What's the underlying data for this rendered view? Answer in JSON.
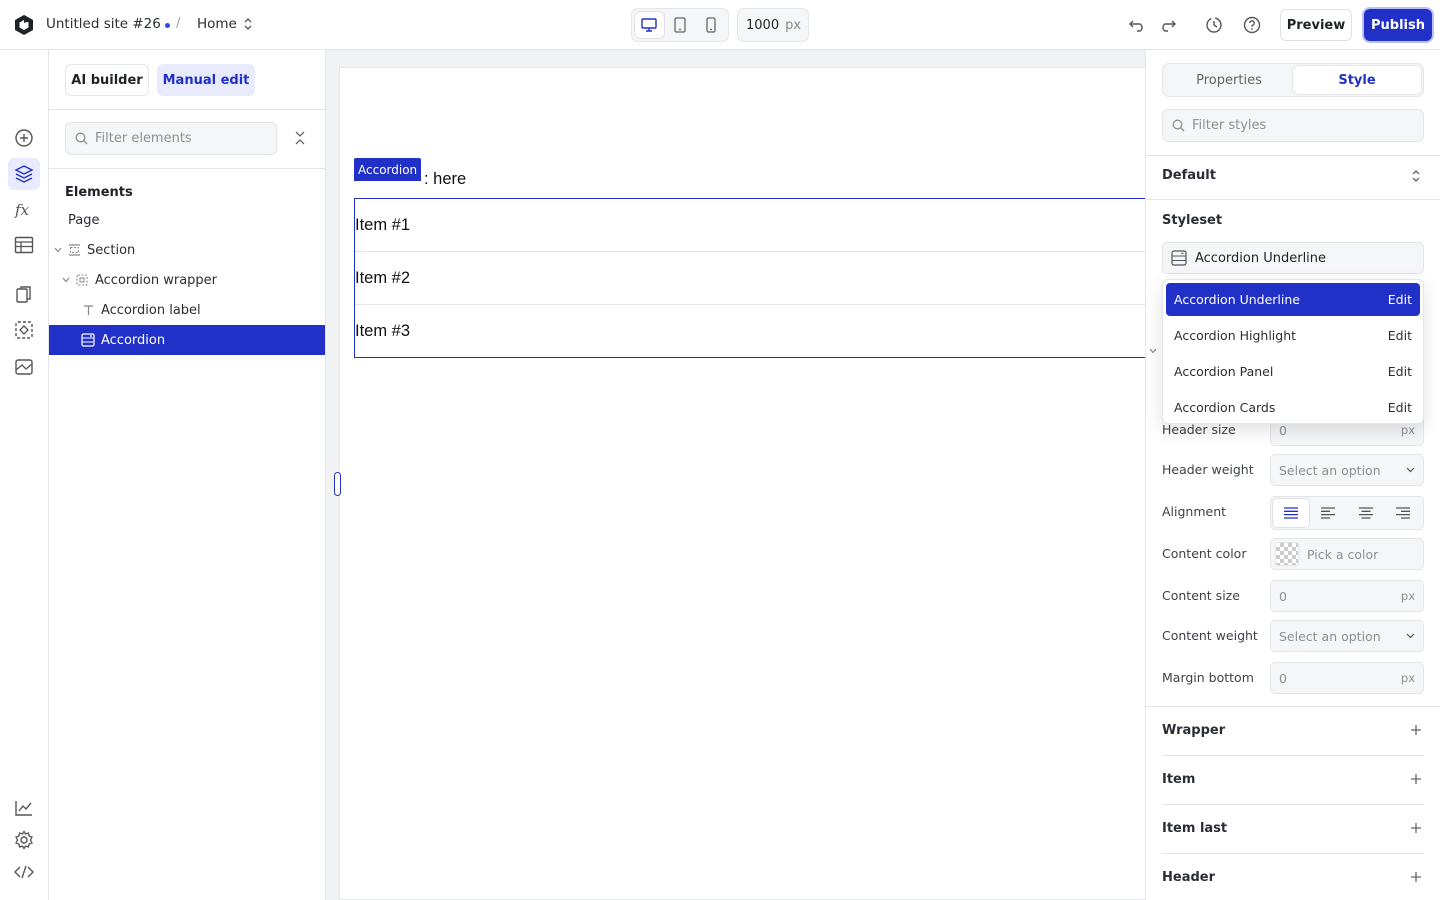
{
  "topbar": {
    "site_name": "Untitled site #26",
    "separator": "/",
    "page_name": "Home",
    "width_value": "1000",
    "width_unit": "px",
    "preview_label": "Preview",
    "publish_label": "Publish"
  },
  "left_panel": {
    "mode_ai": "AI builder",
    "mode_manual": "Manual edit",
    "filter_placeholder": "Filter elements",
    "elements_title": "Elements",
    "tree": [
      {
        "label": "Page"
      },
      {
        "label": "Section"
      },
      {
        "label": "Accordion wrapper"
      },
      {
        "label": "Accordion label"
      },
      {
        "label": "Accordion"
      }
    ]
  },
  "canvas": {
    "tag": "Accordion",
    "label_suffix": ": here",
    "items": [
      "Item #1",
      "Item #2",
      "Item #3"
    ]
  },
  "right_panel": {
    "tab_properties": "Properties",
    "tab_style": "Style",
    "filter_placeholder": "Filter styles",
    "state": "Default",
    "styleset_title": "Styleset",
    "styleset_value": "Accordion Underline",
    "dropdown": [
      {
        "label": "Accordion Underline",
        "action": "Edit"
      },
      {
        "label": "Accordion Highlight",
        "action": "Edit"
      },
      {
        "label": "Accordion Panel",
        "action": "Edit"
      },
      {
        "label": "Accordion Cards",
        "action": "Edit"
      }
    ],
    "props": {
      "header_size_label": "Header size",
      "header_size_value": "0",
      "header_weight_label": "Header weight",
      "header_weight_value": "Select an option",
      "alignment_label": "Alignment",
      "content_color_label": "Content color",
      "content_color_value": "Pick a color",
      "content_size_label": "Content size",
      "content_size_value": "0",
      "content_weight_label": "Content weight",
      "content_weight_value": "Select an option",
      "margin_bottom_label": "Margin bottom",
      "margin_bottom_value": "0",
      "unit": "px"
    },
    "sections": [
      "Wrapper",
      "Item",
      "Item last",
      "Header"
    ]
  },
  "colors": {
    "accent": "#2130c6",
    "accent_light": "#e8ebfd",
    "border": "#e3e5e8"
  }
}
